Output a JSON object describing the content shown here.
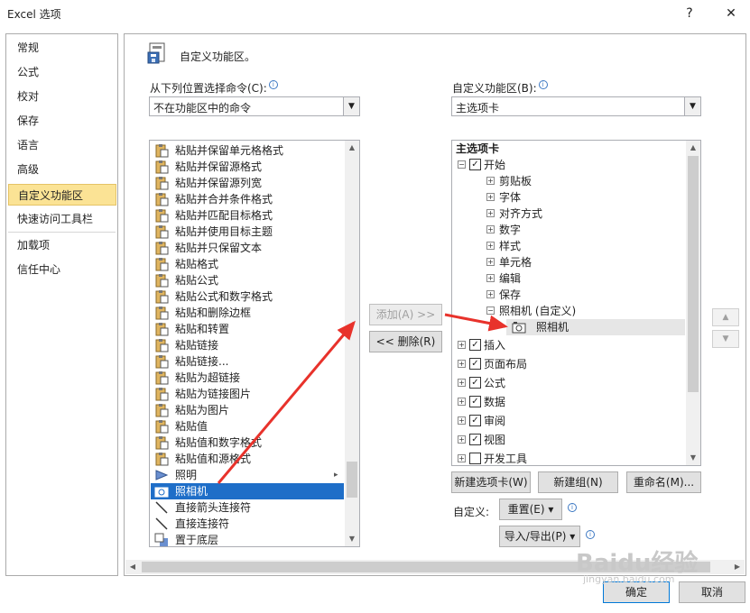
{
  "window": {
    "title": "Excel 选项",
    "help": "?",
    "close": "✕"
  },
  "nav": {
    "items": [
      {
        "label": "常规"
      },
      {
        "label": "公式"
      },
      {
        "label": "校对"
      },
      {
        "label": "保存"
      },
      {
        "label": "语言"
      },
      {
        "label": "高级"
      },
      {
        "label": "自定义功能区"
      },
      {
        "label": "快速访问工具栏"
      },
      {
        "label": "加载项"
      },
      {
        "label": "信任中心"
      }
    ],
    "selected": "自定义功能区"
  },
  "header": {
    "title": "自定义功能区。"
  },
  "commands": {
    "label": "从下列位置选择命令(C):",
    "combo_value": "不在功能区中的命令",
    "items": [
      {
        "label": "粘贴并保留单元格格式"
      },
      {
        "label": "粘贴并保留源格式"
      },
      {
        "label": "粘贴并保留源列宽"
      },
      {
        "label": "粘贴并合并条件格式"
      },
      {
        "label": "粘贴并匹配目标格式"
      },
      {
        "label": "粘贴并使用目标主题"
      },
      {
        "label": "粘贴并只保留文本"
      },
      {
        "label": "粘贴格式"
      },
      {
        "label": "粘贴公式"
      },
      {
        "label": "粘贴公式和数字格式"
      },
      {
        "label": "粘贴和删除边框"
      },
      {
        "label": "粘贴和转置"
      },
      {
        "label": "粘贴链接"
      },
      {
        "label": "粘贴链接..."
      },
      {
        "label": "粘贴为超链接"
      },
      {
        "label": "粘贴为链接图片"
      },
      {
        "label": "粘贴为图片"
      },
      {
        "label": "粘贴值"
      },
      {
        "label": "粘贴值和数字格式"
      },
      {
        "label": "粘贴值和源格式"
      },
      {
        "label": "照明",
        "submenu": "▸"
      },
      {
        "label": "照相机"
      },
      {
        "label": "直接箭头连接符"
      },
      {
        "label": "直接连接符"
      },
      {
        "label": "置于底层"
      }
    ],
    "selected": "照相机"
  },
  "middle": {
    "add": "添加(A) >>",
    "remove": "<< 删除(R)"
  },
  "ribbon": {
    "label": "自定义功能区(B):",
    "combo_value": "主选项卡",
    "tree_header": "主选项卡",
    "start_group": "开始",
    "start_children": [
      "剪贴板",
      "字体",
      "对齐方式",
      "数字",
      "样式",
      "单元格",
      "编辑",
      "保存"
    ],
    "custom_group": "照相机 (自定义)",
    "custom_item": "照相机",
    "tabs": [
      {
        "label": "插入",
        "checked": true
      },
      {
        "label": "页面布局",
        "checked": true
      },
      {
        "label": "公式",
        "checked": true
      },
      {
        "label": "数据",
        "checked": true
      },
      {
        "label": "审阅",
        "checked": true
      },
      {
        "label": "视图",
        "checked": true
      },
      {
        "label": "开发工具",
        "checked": false
      }
    ],
    "new_tab": "新建选项卡(W)",
    "new_group": "新建组(N)",
    "rename": "重命名(M)...",
    "customize_label": "自定义:",
    "reset": "重置(E) ▾",
    "import_export": "导入/导出(P) ▾"
  },
  "footer": {
    "ok": "确定",
    "cancel": "取消"
  },
  "watermark": {
    "brand": "Baidu经验",
    "url": "jingyan.baidu.com"
  },
  "colors": {
    "selection": "#1e6ec8",
    "nav_highlight": "#fbe395",
    "arrow": "#e8322b"
  }
}
